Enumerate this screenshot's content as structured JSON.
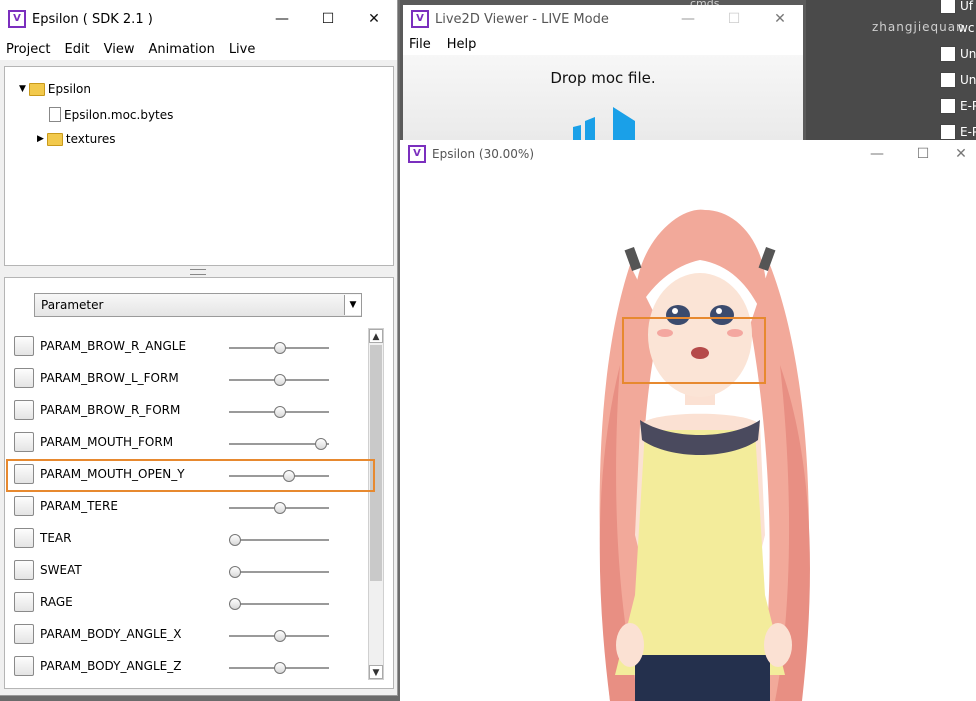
{
  "desktop": {
    "watermark": "zhangjiequan",
    "items": [
      "Uf",
      "wc",
      "Un",
      "Un",
      "E-P",
      "E-P"
    ],
    "top_text": "cmds"
  },
  "sdk_window": {
    "title": "Epsilon ( SDK 2.1 )",
    "menu": [
      "Project",
      "Edit",
      "View",
      "Animation",
      "Live"
    ],
    "tree": {
      "root": "Epsilon",
      "children": [
        "Epsilon.moc.bytes",
        "textures"
      ]
    },
    "dropdown_value": "Parameter",
    "params": [
      {
        "name": "PARAM_BROW_R_ANGLE",
        "value": 0.5
      },
      {
        "name": "PARAM_BROW_L_FORM",
        "value": 0.5
      },
      {
        "name": "PARAM_BROW_R_FORM",
        "value": 0.5
      },
      {
        "name": "PARAM_MOUTH_FORM",
        "value": 0.95
      },
      {
        "name": "PARAM_MOUTH_OPEN_Y",
        "value": 0.6
      },
      {
        "name": "PARAM_TERE",
        "value": 0.5
      },
      {
        "name": "TEAR",
        "value": 0.0
      },
      {
        "name": "SWEAT",
        "value": 0.0
      },
      {
        "name": "RAGE",
        "value": 0.0
      },
      {
        "name": "PARAM_BODY_ANGLE_X",
        "value": 0.5
      },
      {
        "name": "PARAM_BODY_ANGLE_Z",
        "value": 0.5
      }
    ]
  },
  "viewer_window": {
    "title": "Live2D Viewer - LIVE Mode",
    "menu": [
      "File",
      "Help"
    ],
    "drop_text": "Drop moc file."
  },
  "render_window": {
    "title": "Epsilon (30.00%)"
  },
  "colors": {
    "highlight": "#e7892f",
    "app_icon": "#7b2fbe",
    "hair": "#f2a99a",
    "dress": "#f3ec9b"
  }
}
